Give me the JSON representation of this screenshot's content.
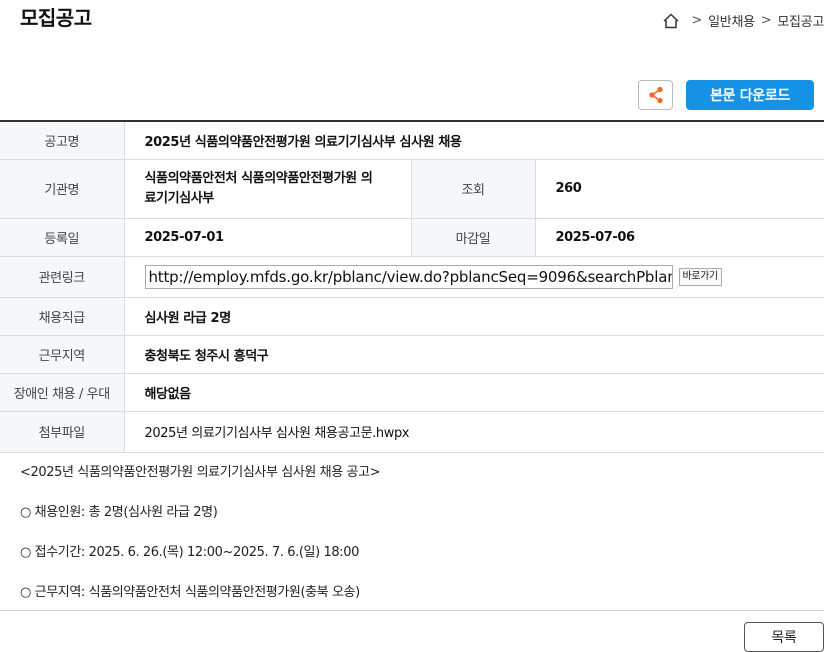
{
  "header": {
    "page_title": "모집공고",
    "breadcrumb": [
      "일반채용",
      "모집공고"
    ],
    "separator": ">"
  },
  "actions": {
    "download_label": "본문 다운로드"
  },
  "colors": {
    "accent": "#1592e6",
    "share_icon": "#f26522"
  },
  "info_table": {
    "title_label": "공고명",
    "title_value": "2025년 식품의약품안전평가원 의료기기심사부 심사원 채용",
    "org_label": "기관명",
    "org_value_line1": "식품의약품안전처 식품의약품안전평가원 의",
    "org_value_line2": "료기기심사부",
    "views_label": "조회",
    "views_value": "260",
    "reg_label": "등록일",
    "reg_value": "2025-07-01",
    "deadline_label": "마감일",
    "deadline_value": "2025-07-06",
    "link_label": "관련링크",
    "link_value": "http://employ.mfds.go.kr/pblanc/view.do?pblancSeq=9096&searchPblan",
    "link_go_label": "바로가기",
    "position_label": "채용직급",
    "position_value": "심사원 라급 2명",
    "location_label": "근무지역",
    "location_value": "충청북도 청주시 흥덕구",
    "disability_label": "장애인 채용 / 우대",
    "disability_value": "해당없음",
    "attachment_label": "첨부파일",
    "attachment_value": "2025년 의료기기심사부 심사원 채용공고문.hwpx"
  },
  "body_text": [
    "<2025년 식품의약품안전평가원 의료기기심사부 심사원 채용 공고>",
    "○ 채용인원: 총 2명(심사원 라급 2명)",
    "○ 접수기간: 2025. 6. 26.(목) 12:00~2025. 7. 6.(일) 18:00",
    "○ 근무지역: 식품의약품안전처 식품의약품안전평가원(충북 오송)"
  ],
  "footer": {
    "list_label": "목록"
  }
}
